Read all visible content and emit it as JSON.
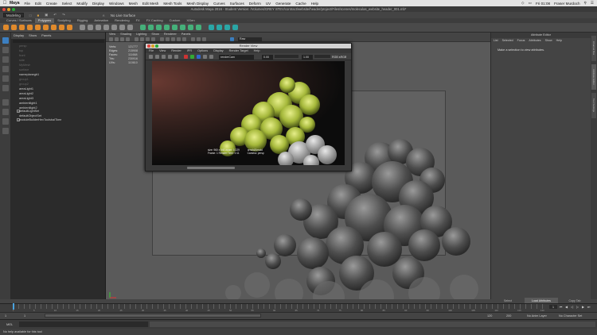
{
  "menubar": {
    "app": "Maya",
    "items": [
      "File",
      "Edit",
      "Create",
      "Select",
      "Modify",
      "Display",
      "Windows",
      "Mesh",
      "Edit Mesh",
      "Mesh Tools",
      "Mesh Display",
      "Curves",
      "Surfaces",
      "Deform",
      "UV",
      "Generate",
      "Cache",
      "Help"
    ],
    "clock": "Fri 01:08",
    "user": "Fraser Murdoch"
  },
  "window": {
    "title": "Autodesk Maya 2016 - Student Version: /Volumes/GREY STEV/contract/website/header/project/Files/scenes/moleculas_website_header_001.mb*"
  },
  "mayamenu": {
    "mode": "Modeling",
    "live_surface": "No Live Surface"
  },
  "shelf_tabs": [
    "Curves / Surfaces",
    "Polygons",
    "Sculpting",
    "Rigging",
    "Animation",
    "Rendering",
    "FX",
    "FX Caching",
    "Custom",
    "XGen"
  ],
  "shelf_active": "Polygons",
  "outliner": {
    "menu": [
      "Display",
      "Show",
      "Panels"
    ],
    "items": [
      "persp",
      "top",
      "front",
      "side",
      "MyMesh",
      "surface",
      "nameplanegb1",
      "group1",
      "group2",
      "areaLight1",
      "areaLight2",
      "areaLight3",
      "ambientlight1",
      "ambientlight2",
      "defaultLightSet",
      "defaultObjectSet",
      "moduleBuilderHexToolsbalTkee"
    ]
  },
  "viewport": {
    "menu": [
      "View",
      "Shading",
      "Lighting",
      "Show",
      "Renderer",
      "Panels"
    ],
    "colorspace": "Raw",
    "hud": [
      {
        "k": "Verts:",
        "v": "121777"
      },
      {
        "k": "Edges:",
        "v": "215908"
      },
      {
        "k": "Faces:",
        "v": "111668"
      },
      {
        "k": "Tris:",
        "v": "230916"
      },
      {
        "k": "UVs:",
        "v": "110610"
      }
    ],
    "camera": "persp"
  },
  "render_view": {
    "title": "Render View",
    "menu": [
      "File",
      "View",
      "Render",
      "IPR",
      "Options",
      "Display",
      "Render Target",
      "Help"
    ],
    "camera": "renderCam",
    "value1": "0.00",
    "value2": "1.00",
    "color_mode": "RGB sRGB",
    "info": [
      "size: 960 x 540 zoom: 0.229",
      "Frame: 1   Render Time: 0:11",
      "arnold/Arnold",
      "Camera: persp"
    ]
  },
  "attribute_editor": {
    "title": "Attribute Editor",
    "menu": [
      "List",
      "Selected",
      "Focus",
      "Attributes",
      "Show",
      "Help"
    ],
    "message": "Make a selection to view attributes.",
    "tabs": [
      "Select",
      "Load Attributes",
      "Copy Tab"
    ],
    "active_tab": "Load Attributes"
  },
  "side_tabs": [
    "Channel Box",
    "Attribute Editor",
    "Tool Settings"
  ],
  "timeline": {
    "ticks": [
      "1",
      "5",
      "10",
      "15",
      "20",
      "25",
      "30",
      "35",
      "40",
      "45",
      "50",
      "55",
      "60",
      "65",
      "70",
      "75",
      "80",
      "85",
      "90",
      "95",
      "100",
      "105",
      "110",
      "115",
      "120"
    ],
    "current_frame": "1",
    "range_start": "1",
    "playback_start": "1",
    "playback_end": "120",
    "range_end": "120",
    "anim_end": "200",
    "anim_layer": "No Anim Layer",
    "char_set": "No Character Set"
  },
  "command": {
    "lang": "MEL"
  },
  "help_line": "No help available for this tool"
}
